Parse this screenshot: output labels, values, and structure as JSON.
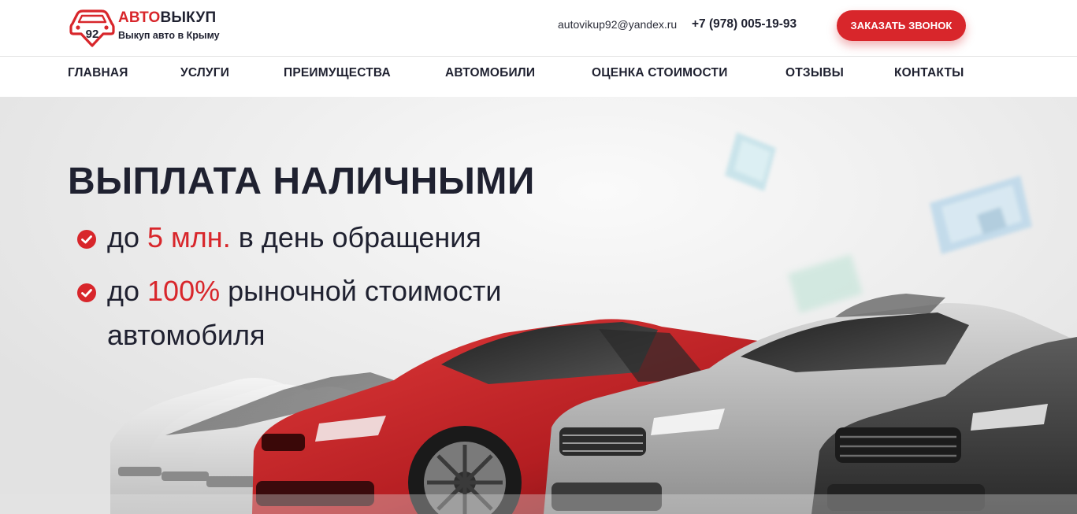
{
  "brand": {
    "name_red": "АВТО",
    "name_dark": "ВЫКУП",
    "badge_number": "92",
    "tagline": "Выкуп авто в Крыму"
  },
  "contacts": {
    "email": "autovikup92@yandex.ru",
    "phone": "+7 (978) 005-19-93"
  },
  "cta": {
    "label": "ЗАКАЗАТЬ ЗВОНОК"
  },
  "nav": {
    "items": [
      {
        "label": "ГЛАВНАЯ"
      },
      {
        "label": "УСЛУГИ"
      },
      {
        "label": "ПРЕИМУЩЕСТВА"
      },
      {
        "label": "АВТОМОБИЛИ"
      },
      {
        "label": "ОЦЕНКА СТОИМОСТИ"
      },
      {
        "label": "ОТЗЫВЫ"
      },
      {
        "label": "КОНТАКТЫ"
      }
    ]
  },
  "hero": {
    "title": "ВЫПЛАТА НАЛИЧНЫМИ",
    "bullets": [
      {
        "prefix": "до ",
        "accent": "5 млн.",
        "suffix": " в день обращения"
      },
      {
        "prefix": "до ",
        "accent": "100%",
        "suffix": " рыночной стоимости",
        "continuation": "автомобиля"
      }
    ]
  },
  "icons": {
    "logo": "car-pin-logo-icon",
    "bullet": "check-circle-icon"
  },
  "colors": {
    "accent": "#d8262b",
    "text_dark": "#1f2130",
    "background": "#ffffff",
    "hero_background": "#ececec"
  }
}
